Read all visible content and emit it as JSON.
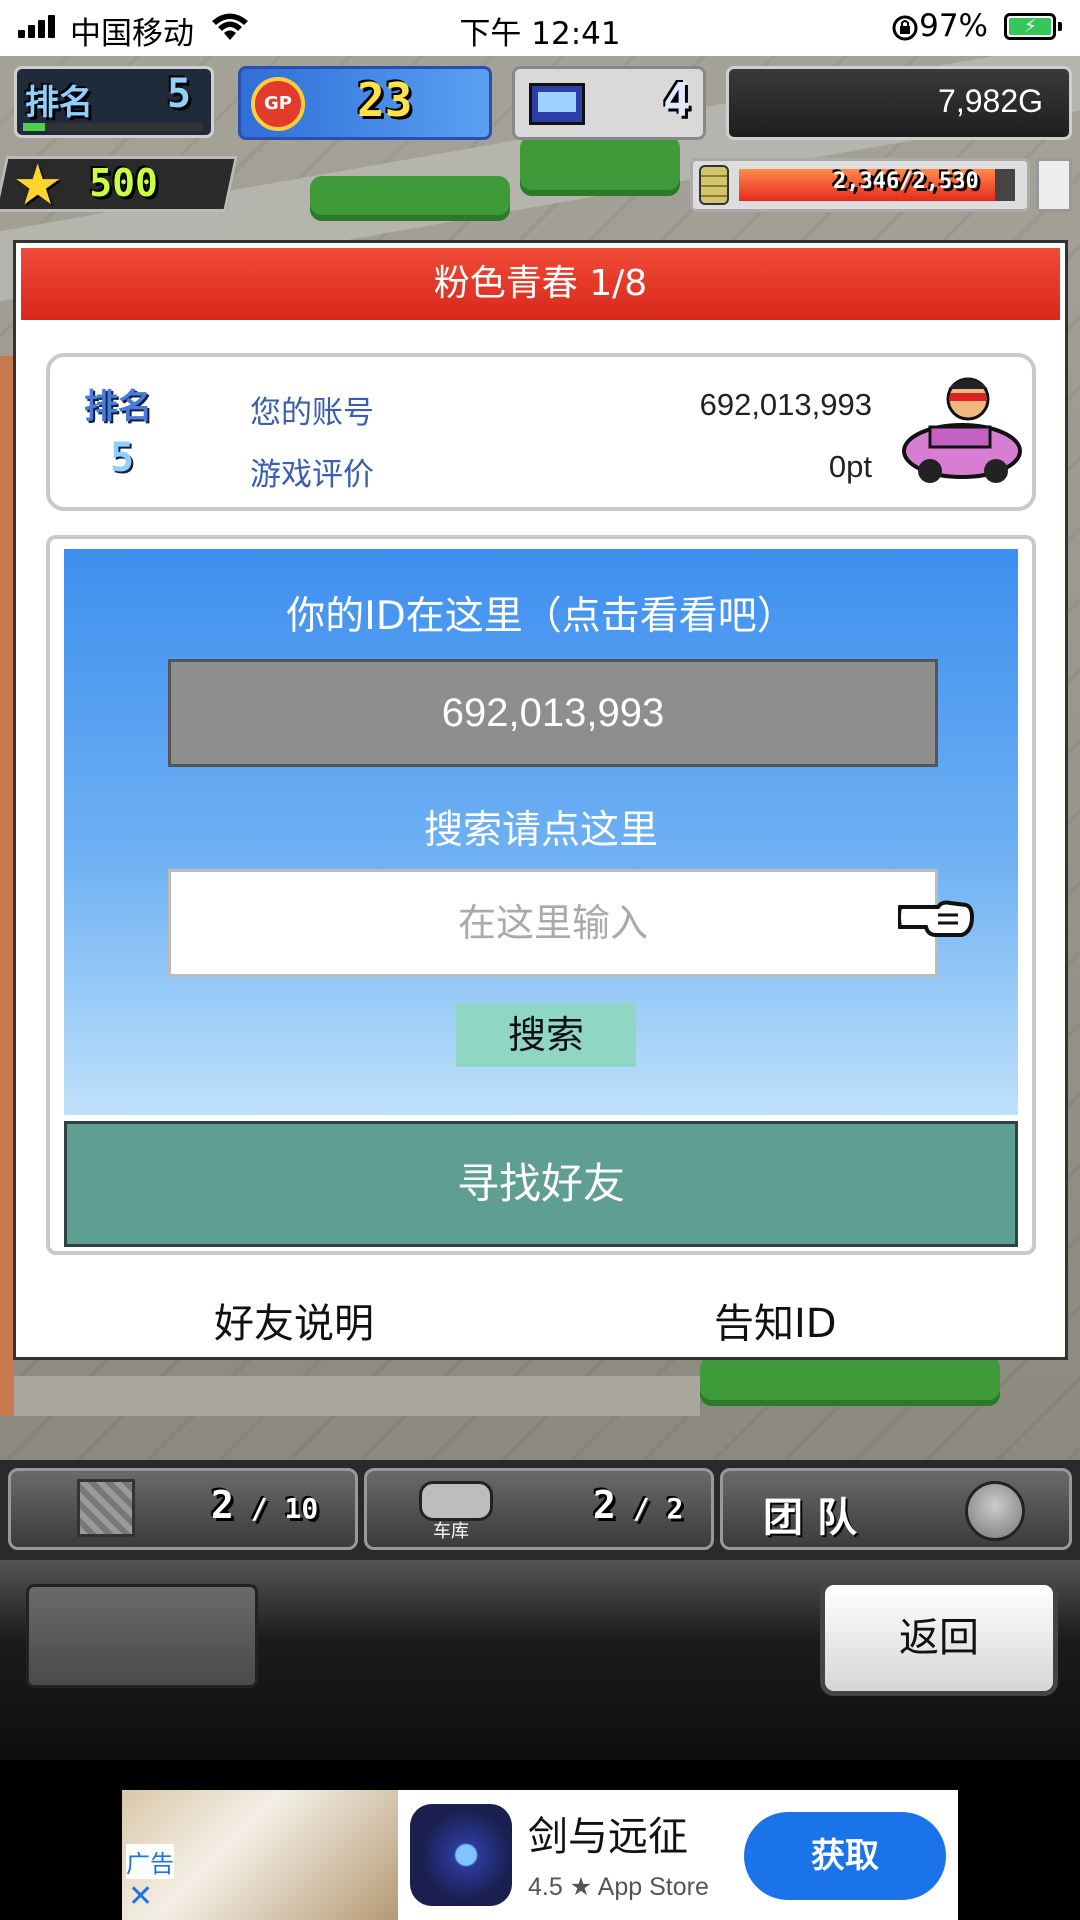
{
  "status_bar": {
    "carrier": "中国移动",
    "time": "下午 12:41",
    "battery": "97%"
  },
  "hud": {
    "rank_label": "排名",
    "rank_value": "5",
    "gp_label": "GP",
    "gp_value": "23",
    "computer_value": "4",
    "money": "7,982G",
    "stars": "500",
    "stamina": "2,346/2,530",
    "stamina_fraction": 0.927
  },
  "dialog": {
    "title": "粉色青春 1/8",
    "rank_label": "排名",
    "rank_value": "5",
    "account_label": "您的账号",
    "account_value": "692,013,993",
    "rating_label": "游戏评价",
    "rating_value": "0pt",
    "id_prompt": "你的ID在这里（点击看看吧）",
    "id_value": "692,013,993",
    "search_prompt": "搜索请点这里",
    "search_placeholder": "在这里输入",
    "search_button": "搜索",
    "find_friend_button": "寻找好友",
    "friend_help_link": "好友说明",
    "share_id_link": "告知ID"
  },
  "bottom_hud": {
    "storage_count": "2",
    "storage_capacity": "10",
    "garage_label": "车库",
    "garage_count": "2",
    "garage_capacity": "2",
    "team_label": "团队",
    "back_button": "返回"
  },
  "ad": {
    "tag": "广告",
    "app_name": "剑与远征",
    "rating": "4.5 ★ App Store",
    "get_button": "获取"
  },
  "colors": {
    "header_red": "#e4392a",
    "panel_blue": "#3e8ff0",
    "friend_teal": "#5f9f93",
    "id_box_gray": "#8e8e8e",
    "search_btn_mint": "#8fd6c4",
    "ad_button_blue": "#1a73e8"
  }
}
